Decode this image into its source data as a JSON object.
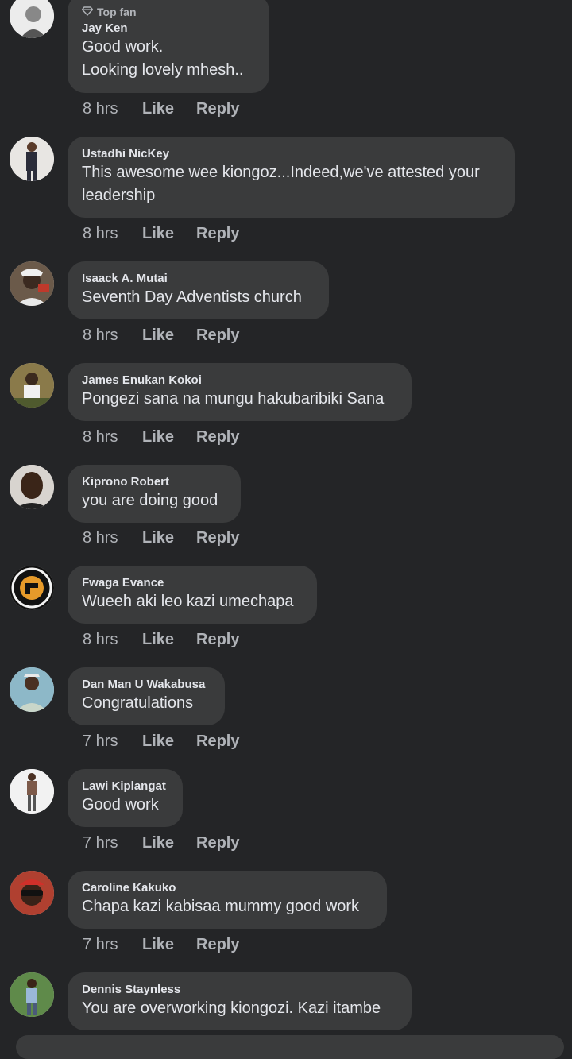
{
  "comments": [
    {
      "badge": "Top fan",
      "name": "Jay Ken",
      "text": "Good work.\nLooking lovely mhesh..",
      "time": "8 hrs",
      "like": "Like",
      "reply": "Reply"
    },
    {
      "name": "Ustadhi NicKey",
      "text": "This awesome wee kiongoz...Indeed,we've attested your\nleadership",
      "time": "8 hrs",
      "like": "Like",
      "reply": "Reply"
    },
    {
      "name": "Isaack A. Mutai",
      "text": "Seventh Day Adventists church",
      "time": "8 hrs",
      "like": "Like",
      "reply": "Reply"
    },
    {
      "name": "James Enukan Kokoi",
      "text": "Pongezi sana na mungu hakubaribiki Sana",
      "time": "8 hrs",
      "like": "Like",
      "reply": "Reply"
    },
    {
      "name": "Kiprono Robert",
      "text": "you are doing good",
      "time": "8 hrs",
      "like": "Like",
      "reply": "Reply"
    },
    {
      "name": "Fwaga Evance",
      "text": "Wueeh aki leo kazi umechapa",
      "time": "8 hrs",
      "like": "Like",
      "reply": "Reply"
    },
    {
      "name": "Dan Man U Wakabusa",
      "text": "Congratulations",
      "time": "7 hrs",
      "like": "Like",
      "reply": "Reply"
    },
    {
      "name": "Lawi Kiplangat",
      "text": "Good work",
      "time": "7 hrs",
      "like": "Like",
      "reply": "Reply"
    },
    {
      "name": "Caroline Kakuko",
      "text": "Chapa kazi kabisaa mummy good work",
      "time": "7 hrs",
      "like": "Like",
      "reply": "Reply"
    },
    {
      "name": "Dennis Staynless",
      "text": "You are overworking kiongozi. Kazi itambe"
    }
  ],
  "icons": {
    "badge": "diamond-icon"
  },
  "colors": {
    "background": "#242527",
    "bubble": "#3a3b3c",
    "text": "#e4e6eb",
    "muted": "#b0b3b8"
  }
}
